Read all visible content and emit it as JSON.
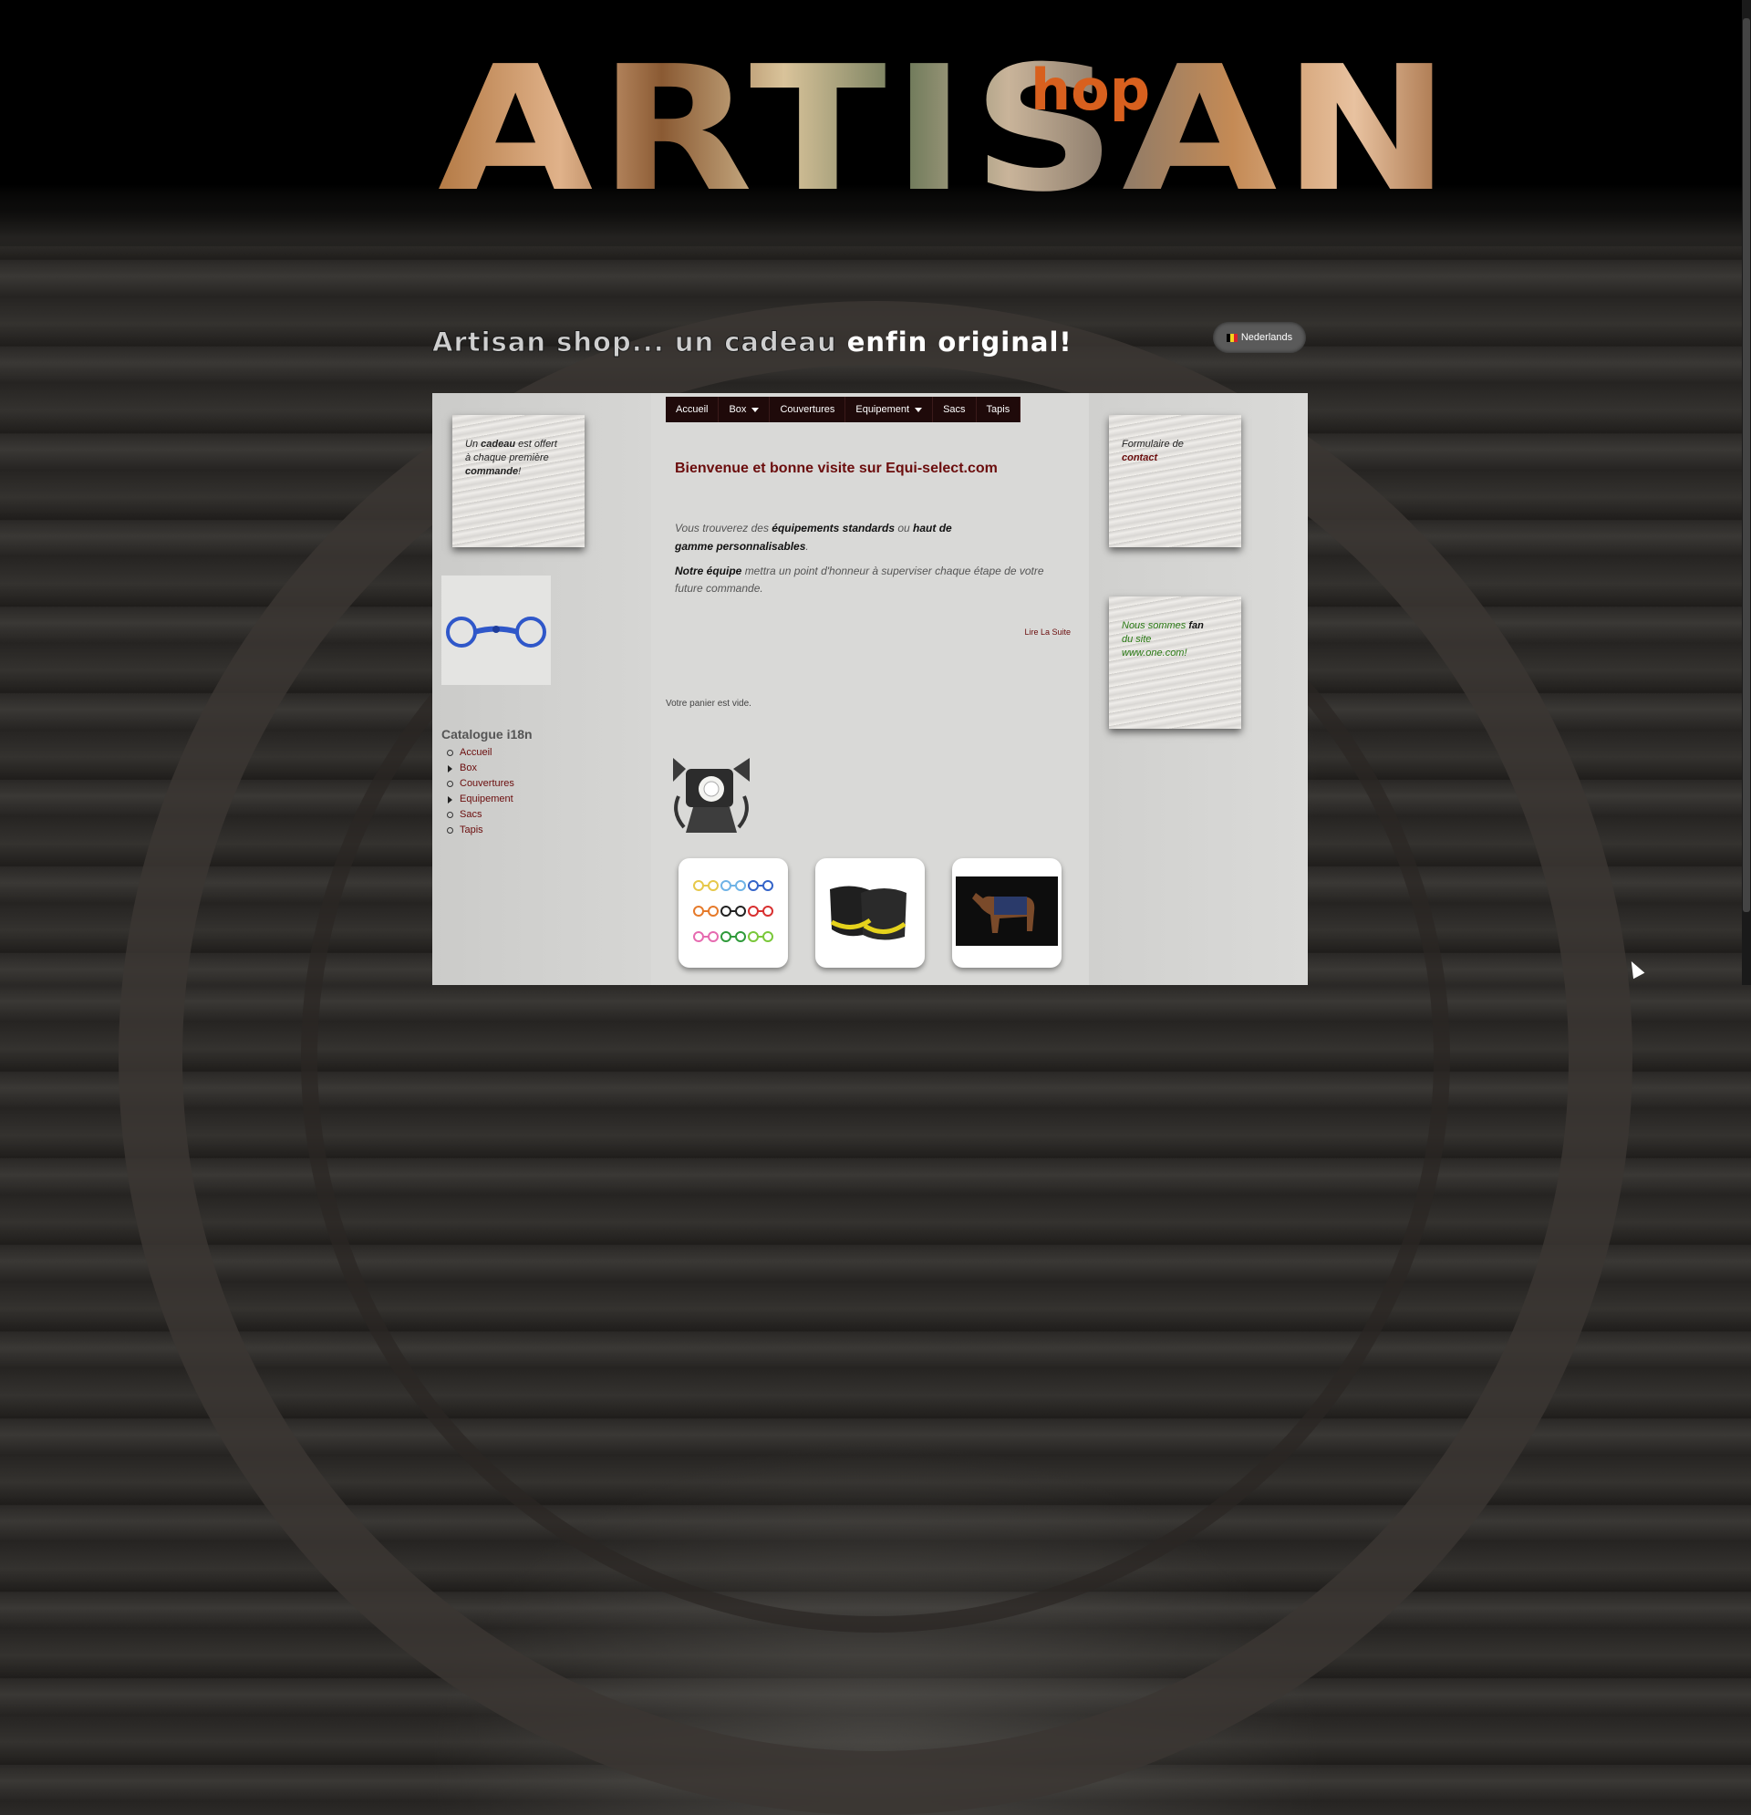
{
  "brand": {
    "logo_main": "ARTISAN",
    "logo_accent": "hop"
  },
  "tagline": {
    "part1": "Artisan shop... un cadeau",
    "part2": "enfin original!"
  },
  "language": {
    "label": "Nederlands"
  },
  "menu": {
    "items": [
      {
        "label": "Accueil"
      },
      {
        "label": "Box"
      },
      {
        "label": "Couvertures"
      },
      {
        "label": "Equipement"
      },
      {
        "label": "Sacs"
      },
      {
        "label": "Tapis"
      }
    ]
  },
  "left": {
    "gift_note": {
      "w1": "Un",
      "w2": "cadeau",
      "w3": "est offert à chaque première",
      "w4": "commande",
      "w5": "!"
    },
    "catalog_title": "Catalogue i18n",
    "catalog_items": [
      "Accueil",
      "Box",
      "Couvertures",
      "Equipement",
      "Sacs",
      "Tapis"
    ]
  },
  "main": {
    "welcome": "Bienvenue et bonne visite sur Equi-select.com",
    "p1": {
      "a": "Vous trouverez des",
      "b": "équipements standards",
      "c": "ou",
      "d": "haut de gamme personnalisables",
      "e": "."
    },
    "p2": {
      "a": "Notre équipe",
      "b": "mettra un point d'honneur à superviser chaque étape de votre future commande."
    },
    "read_more": "Lire La Suite",
    "cart": "Votre panier est vide."
  },
  "right": {
    "contact_note": {
      "a": "Formulaire de",
      "b": "contact"
    },
    "fan_note": {
      "a": "Nous sommes",
      "b": "fan",
      "c": "du site",
      "d": "www.one.com!"
    }
  },
  "colors": {
    "accent": "#6b0d0d",
    "menu_bg": "#1f0a0a",
    "logo_shop": "#d8601e"
  }
}
